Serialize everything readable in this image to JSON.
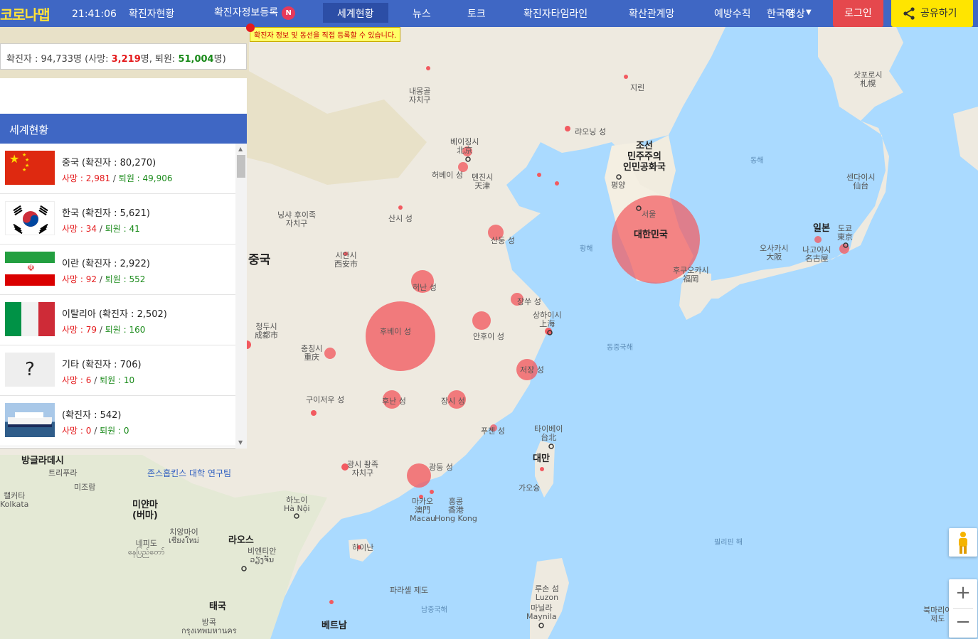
{
  "header": {
    "logo": "코로나맵",
    "clock": "21:41:06",
    "nav": [
      {
        "label": "확진자현황"
      },
      {
        "label": "확진자정보등록",
        "badge": "N"
      },
      {
        "label": "세계현황",
        "active": true
      },
      {
        "label": "뉴스"
      },
      {
        "label": "토크"
      },
      {
        "label": "확진자타임라인"
      },
      {
        "label": "확산관계망"
      },
      {
        "label": "예방수칙"
      }
    ],
    "language": "한국어",
    "language_overlap": "영상",
    "login": "로그인",
    "share": "공유하기"
  },
  "notice": "확진자 정보 및 동선을 직접 등록할 수 있습니다.",
  "stats": {
    "prefix": "확진자 : ",
    "confirmed": "94,733",
    "unit": "명",
    "death_prefix": " (사망: ",
    "deaths": "3,219",
    "recov_prefix": "명, 퇴원: ",
    "recovered": "51,004",
    "suffix": "명)"
  },
  "world_header": "세계현황",
  "countries": [
    {
      "name": "중국 (확진자 : 80,270)",
      "death_label": "사망 : 2,981",
      "sep": " / ",
      "recov_label": "퇴원 : 49,906",
      "flag": "china"
    },
    {
      "name": "한국 (확진자 : 5,621)",
      "death_label": "사망 : 34",
      "sep": " / ",
      "recov_label": "퇴원 : 41",
      "flag": "korea"
    },
    {
      "name": "이란 (확진자 : 2,922)",
      "death_label": "사망 : 92",
      "sep": " / ",
      "recov_label": "퇴원 : 552",
      "flag": "iran"
    },
    {
      "name": "이탈리아 (확진자 : 2,502)",
      "death_label": "사망 : 79",
      "sep": " / ",
      "recov_label": "퇴원 : 160",
      "flag": "italy"
    },
    {
      "name": "기타 (확진자 : 706)",
      "death_label": "사망 : 6",
      "sep": " / ",
      "recov_label": "퇴원 : 10",
      "flag": "unknown",
      "flag_text": "?"
    },
    {
      "name": "(확진자 : 542)",
      "death_label": "사망 : 0",
      "sep": " / ",
      "recov_label": "퇴원 : 0",
      "flag": "ship"
    }
  ],
  "map_labels": {
    "inner_mongolia": "내몽골\n자치구",
    "jilin": "지린",
    "sapporo": "삿포로시\n札幌",
    "liaoning": "랴오닝 성",
    "north_korea": "조선\n민주주의\n인민공화국",
    "pyongyang": "평양",
    "beijing": "베이징시\n北京",
    "hebei": "허베이 성",
    "tianjin": "톈진시\n天津",
    "donghae": "동해",
    "sendai": "센다이시\n仙台",
    "ningxia": "닝샤 후이족\n자치구",
    "shanxi": "산시 성",
    "shandong": "산둥 성",
    "seoul": "서울",
    "south_korea": "대한민국",
    "japan": "일본",
    "tokyo": "도쿄\n東京",
    "osaka": "오사카시\n大阪",
    "nagoya": "나고야시\n名古屋",
    "yellow_sea": "황해",
    "xian": "시안시\n西安市",
    "china": "중국",
    "henan": "허난 성",
    "fukuoka": "후쿠오카시\n福岡",
    "jiangsu": "장쑤 성",
    "shanghai": "상하이시\n上海",
    "chengdu": "청두시\n成都市",
    "hubei": "후베이 성",
    "anhui": "안후이 성",
    "chongqing": "충칭시\n重庆",
    "east_china_sea": "동중국해",
    "zhejiang": "저장 성",
    "guizhou": "구이저우 성",
    "hunan": "후난 성",
    "jiangxi": "장시 성",
    "fujian": "푸젠 성",
    "taipei": "타이베이\n台北",
    "taiwan": "대만",
    "bangladesh": "방글라데시",
    "tripura": "트리푸라",
    "mizoram": "미조람",
    "johns_hopkins": "존스홉킨스 대학 연구팀",
    "guangxi": "광시 좡족\n자치구",
    "guangdong": "광둥 성",
    "kaohsiung": "가오슝",
    "kolkata": "캘커타\nKolkata",
    "myanmar": "미얀마\n(버마)",
    "hanoi": "하노이\nHà Nội",
    "macau": "마카오\n澳門\nMacau",
    "hongkong": "홍콩\n香港\nHong Kong",
    "naypyidaw": "네피도\nနေပြည်တော်",
    "chiangmai": "치앙마이\nเชียงใหม่",
    "laos": "라오스",
    "vientiane": "비엔티안\nວຽງຈັນ",
    "hainan": "하이난",
    "philippine_sea": "필리핀 해",
    "paracel": "파라셀 제도",
    "south_china_sea": "남중국해",
    "luzon": "루손 섬\nLuzon",
    "manila": "마닐라\nMaynila",
    "thailand": "태국",
    "bangkok": "방콕\nกรุงเทพมหานคร",
    "vietnam": "베트남",
    "northern_mariana": "북마리아\n제도"
  }
}
